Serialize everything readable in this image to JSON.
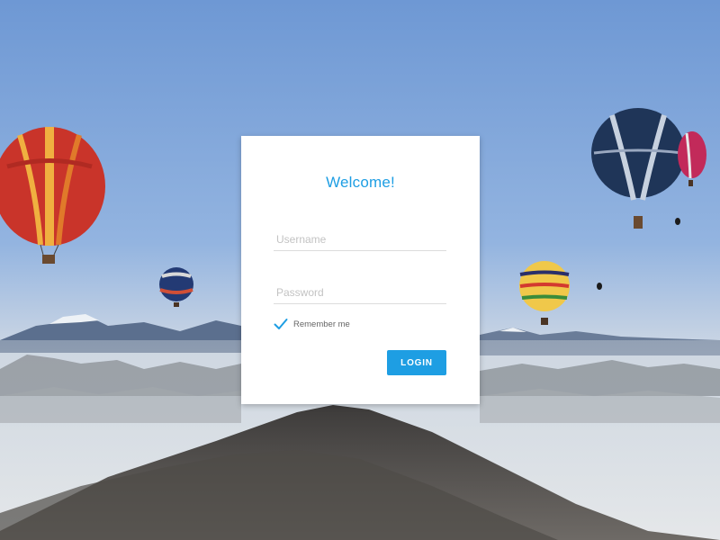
{
  "login": {
    "title": "Welcome!",
    "username_placeholder": "Username",
    "username_value": "",
    "password_placeholder": "Password",
    "password_value": "",
    "remember_label": "Remember me",
    "remember_checked": true,
    "login_label": "LOGIN"
  },
  "colors": {
    "accent": "#1e9ee3",
    "sky_top": "#6e98d4",
    "sky_bottom": "#dde2e6",
    "card": "#ffffff"
  },
  "icons": {
    "remember_check": "checkmark-icon"
  }
}
